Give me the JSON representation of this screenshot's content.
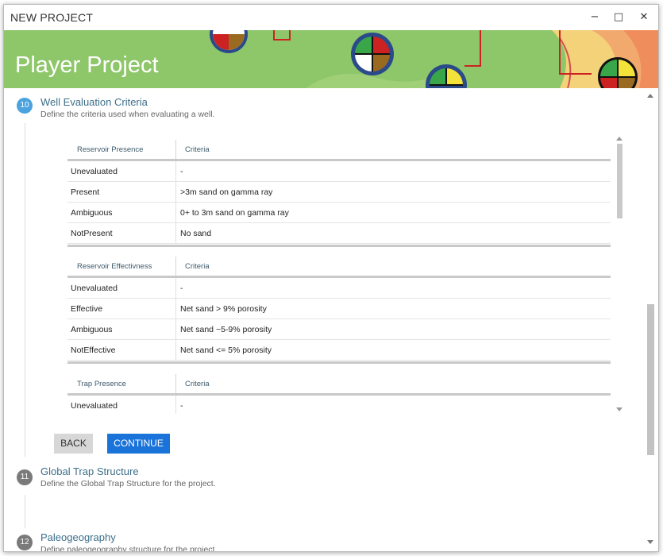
{
  "window": {
    "title": "NEW PROJECT",
    "minimize_glyph": "−",
    "maximize_glyph": "□",
    "close_glyph": "✕"
  },
  "banner": {
    "title": "Player Project"
  },
  "steps": [
    {
      "number": "10",
      "title": "Well Evaluation Criteria",
      "description": "Define the criteria used when evaluating a well.",
      "color": "#4aa3df"
    },
    {
      "number": "11",
      "title": "Global Trap Structure",
      "description": "Define the Global Trap Structure for the project.",
      "color": "#7a7a7a"
    },
    {
      "number": "12",
      "title": "Paleogeography",
      "description": "Define paleogeography structure for the project.",
      "color": "#7a7a7a"
    }
  ],
  "tables": [
    {
      "header": [
        "Reservoir Presence",
        "Criteria"
      ],
      "rows": [
        [
          "Unevaluated",
          "-"
        ],
        [
          "Present",
          ">3m sand on gamma ray"
        ],
        [
          "Ambiguous",
          "0+ to 3m sand on gamma ray"
        ],
        [
          "NotPresent",
          "No sand"
        ]
      ]
    },
    {
      "header": [
        "Reservoir Effectivness",
        "Criteria"
      ],
      "rows": [
        [
          "Unevaluated",
          "-"
        ],
        [
          "Effective",
          "Net sand > 9% porosity"
        ],
        [
          "Ambiguous",
          "Net sand ~5-9% porosity"
        ],
        [
          "NotEffective",
          "Net sand <= 5% porosity"
        ]
      ]
    },
    {
      "header": [
        "Trap Presence",
        "Criteria"
      ],
      "rows": [
        [
          "Unevaluated",
          "-"
        ]
      ]
    }
  ],
  "buttons": {
    "back": "BACK",
    "continue": "CONTINUE"
  },
  "colors": {
    "banner_green": "#8ec66a",
    "accent_blue": "#1a73d9",
    "title_blue": "#3d6f8a"
  }
}
